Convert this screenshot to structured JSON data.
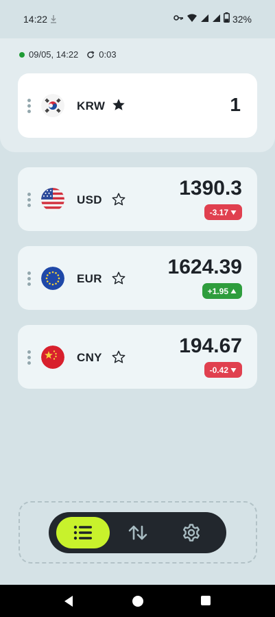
{
  "status_bar": {
    "time": "14:22",
    "battery": "32%",
    "icons": [
      "download-icon",
      "key-icon",
      "wifi-icon",
      "signal-icon",
      "signal-icon",
      "battery-icon"
    ]
  },
  "update_info": {
    "datetime": "09/05, 14:22",
    "countdown": "0:03",
    "status_color": "#1e9b35"
  },
  "base_currency": {
    "code": "KRW",
    "value": "1",
    "favorite": true,
    "flag": "south-korea-flag"
  },
  "currencies": [
    {
      "code": "USD",
      "rate": "1390.3",
      "change": "-3.17",
      "direction": "down",
      "favorite": false,
      "flag": "usa-flag"
    },
    {
      "code": "EUR",
      "rate": "1624.39",
      "change": "+1.95",
      "direction": "up",
      "favorite": false,
      "flag": "eu-flag"
    },
    {
      "code": "CNY",
      "rate": "194.67",
      "change": "-0.42",
      "direction": "down",
      "favorite": false,
      "flag": "china-flag"
    }
  ],
  "bottom_nav": {
    "items": [
      "list-icon",
      "swap-icon",
      "settings-icon"
    ],
    "active": "list-icon",
    "accent_color": "#c8f22c"
  },
  "colors": {
    "background": "#d5e2e6",
    "down": "#e0404f",
    "up": "#2e9d3d",
    "nav_bar": "#22272d"
  }
}
